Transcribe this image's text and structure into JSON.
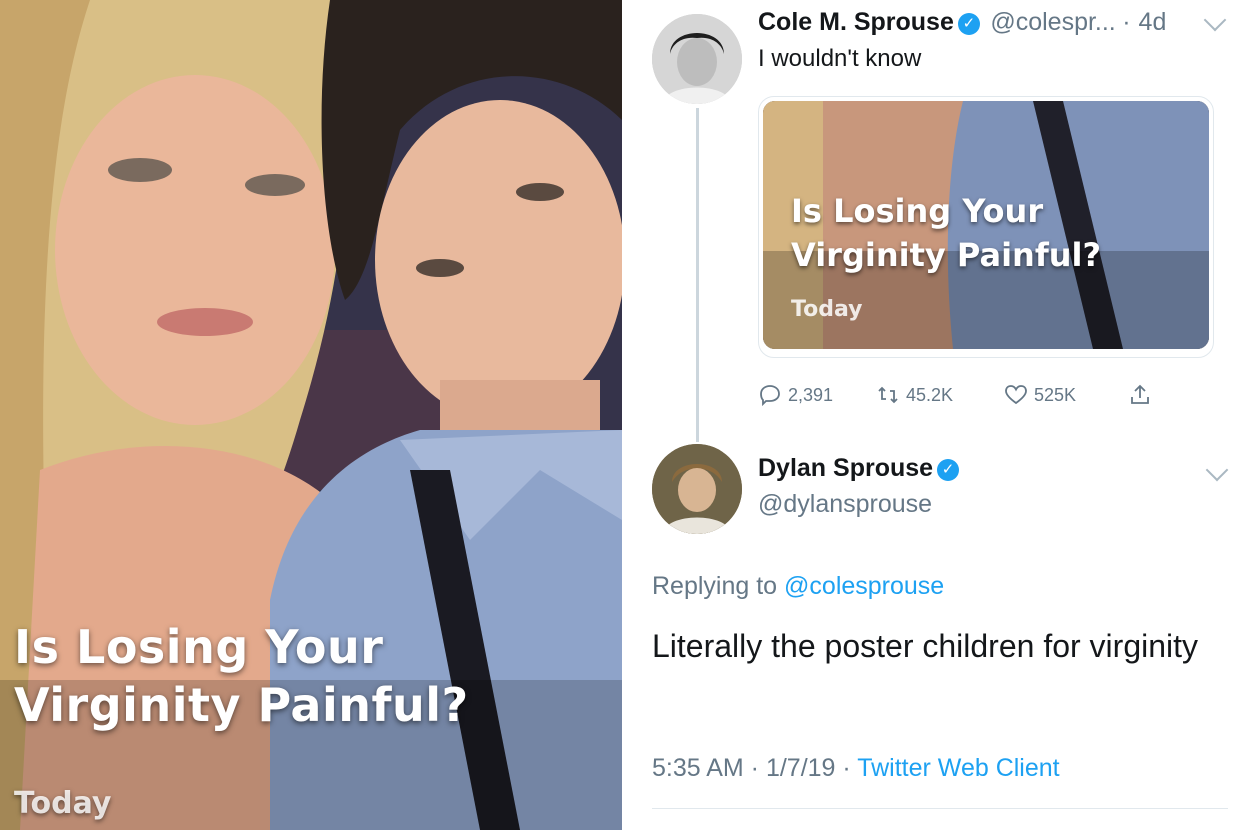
{
  "photo": {
    "headline": "Is Losing Your Virginity Painful?",
    "date": "Today"
  },
  "tweet": {
    "author_name": "Cole M. Sprouse",
    "author_handle": "@colespr...",
    "age": "4d",
    "text": "I wouldn't know",
    "card": {
      "title": "Is Losing Your Virginity Painful?",
      "date": "Today"
    },
    "stats": {
      "replies": "2,391",
      "retweets": "45.2K",
      "likes": "525K"
    }
  },
  "reply": {
    "author_name": "Dylan Sprouse",
    "author_handle": "@dylansprouse",
    "replying_prefix": "Replying to",
    "replying_to": "@colesprouse",
    "text": "Literally the poster children for virginity",
    "time": "5:35 AM",
    "date": "1/7/19",
    "client": "Twitter Web Client"
  },
  "colors": {
    "link": "#1da1f2",
    "secondary_text": "#657786",
    "verified": "#1da1f2"
  },
  "icons": [
    "verified-badge-icon",
    "chevron-down-icon",
    "reply-icon",
    "retweet-icon",
    "like-icon",
    "share-icon"
  ]
}
